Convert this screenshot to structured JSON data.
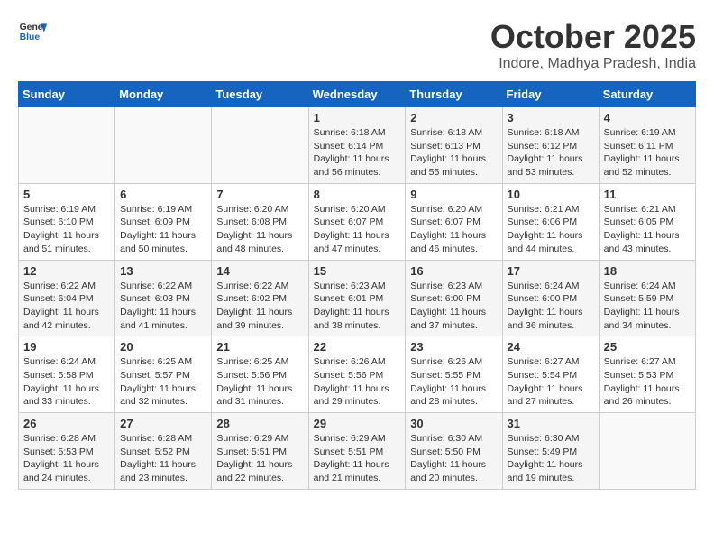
{
  "header": {
    "logo_line1": "General",
    "logo_line2": "Blue",
    "month": "October 2025",
    "location": "Indore, Madhya Pradesh, India"
  },
  "weekdays": [
    "Sunday",
    "Monday",
    "Tuesday",
    "Wednesday",
    "Thursday",
    "Friday",
    "Saturday"
  ],
  "weeks": [
    [
      {
        "day": "",
        "info": ""
      },
      {
        "day": "",
        "info": ""
      },
      {
        "day": "",
        "info": ""
      },
      {
        "day": "1",
        "info": "Sunrise: 6:18 AM\nSunset: 6:14 PM\nDaylight: 11 hours and 56 minutes."
      },
      {
        "day": "2",
        "info": "Sunrise: 6:18 AM\nSunset: 6:13 PM\nDaylight: 11 hours and 55 minutes."
      },
      {
        "day": "3",
        "info": "Sunrise: 6:18 AM\nSunset: 6:12 PM\nDaylight: 11 hours and 53 minutes."
      },
      {
        "day": "4",
        "info": "Sunrise: 6:19 AM\nSunset: 6:11 PM\nDaylight: 11 hours and 52 minutes."
      }
    ],
    [
      {
        "day": "5",
        "info": "Sunrise: 6:19 AM\nSunset: 6:10 PM\nDaylight: 11 hours and 51 minutes."
      },
      {
        "day": "6",
        "info": "Sunrise: 6:19 AM\nSunset: 6:09 PM\nDaylight: 11 hours and 50 minutes."
      },
      {
        "day": "7",
        "info": "Sunrise: 6:20 AM\nSunset: 6:08 PM\nDaylight: 11 hours and 48 minutes."
      },
      {
        "day": "8",
        "info": "Sunrise: 6:20 AM\nSunset: 6:07 PM\nDaylight: 11 hours and 47 minutes."
      },
      {
        "day": "9",
        "info": "Sunrise: 6:20 AM\nSunset: 6:07 PM\nDaylight: 11 hours and 46 minutes."
      },
      {
        "day": "10",
        "info": "Sunrise: 6:21 AM\nSunset: 6:06 PM\nDaylight: 11 hours and 44 minutes."
      },
      {
        "day": "11",
        "info": "Sunrise: 6:21 AM\nSunset: 6:05 PM\nDaylight: 11 hours and 43 minutes."
      }
    ],
    [
      {
        "day": "12",
        "info": "Sunrise: 6:22 AM\nSunset: 6:04 PM\nDaylight: 11 hours and 42 minutes."
      },
      {
        "day": "13",
        "info": "Sunrise: 6:22 AM\nSunset: 6:03 PM\nDaylight: 11 hours and 41 minutes."
      },
      {
        "day": "14",
        "info": "Sunrise: 6:22 AM\nSunset: 6:02 PM\nDaylight: 11 hours and 39 minutes."
      },
      {
        "day": "15",
        "info": "Sunrise: 6:23 AM\nSunset: 6:01 PM\nDaylight: 11 hours and 38 minutes."
      },
      {
        "day": "16",
        "info": "Sunrise: 6:23 AM\nSunset: 6:00 PM\nDaylight: 11 hours and 37 minutes."
      },
      {
        "day": "17",
        "info": "Sunrise: 6:24 AM\nSunset: 6:00 PM\nDaylight: 11 hours and 36 minutes."
      },
      {
        "day": "18",
        "info": "Sunrise: 6:24 AM\nSunset: 5:59 PM\nDaylight: 11 hours and 34 minutes."
      }
    ],
    [
      {
        "day": "19",
        "info": "Sunrise: 6:24 AM\nSunset: 5:58 PM\nDaylight: 11 hours and 33 minutes."
      },
      {
        "day": "20",
        "info": "Sunrise: 6:25 AM\nSunset: 5:57 PM\nDaylight: 11 hours and 32 minutes."
      },
      {
        "day": "21",
        "info": "Sunrise: 6:25 AM\nSunset: 5:56 PM\nDaylight: 11 hours and 31 minutes."
      },
      {
        "day": "22",
        "info": "Sunrise: 6:26 AM\nSunset: 5:56 PM\nDaylight: 11 hours and 29 minutes."
      },
      {
        "day": "23",
        "info": "Sunrise: 6:26 AM\nSunset: 5:55 PM\nDaylight: 11 hours and 28 minutes."
      },
      {
        "day": "24",
        "info": "Sunrise: 6:27 AM\nSunset: 5:54 PM\nDaylight: 11 hours and 27 minutes."
      },
      {
        "day": "25",
        "info": "Sunrise: 6:27 AM\nSunset: 5:53 PM\nDaylight: 11 hours and 26 minutes."
      }
    ],
    [
      {
        "day": "26",
        "info": "Sunrise: 6:28 AM\nSunset: 5:53 PM\nDaylight: 11 hours and 24 minutes."
      },
      {
        "day": "27",
        "info": "Sunrise: 6:28 AM\nSunset: 5:52 PM\nDaylight: 11 hours and 23 minutes."
      },
      {
        "day": "28",
        "info": "Sunrise: 6:29 AM\nSunset: 5:51 PM\nDaylight: 11 hours and 22 minutes."
      },
      {
        "day": "29",
        "info": "Sunrise: 6:29 AM\nSunset: 5:51 PM\nDaylight: 11 hours and 21 minutes."
      },
      {
        "day": "30",
        "info": "Sunrise: 6:30 AM\nSunset: 5:50 PM\nDaylight: 11 hours and 20 minutes."
      },
      {
        "day": "31",
        "info": "Sunrise: 6:30 AM\nSunset: 5:49 PM\nDaylight: 11 hours and 19 minutes."
      },
      {
        "day": "",
        "info": ""
      }
    ]
  ]
}
